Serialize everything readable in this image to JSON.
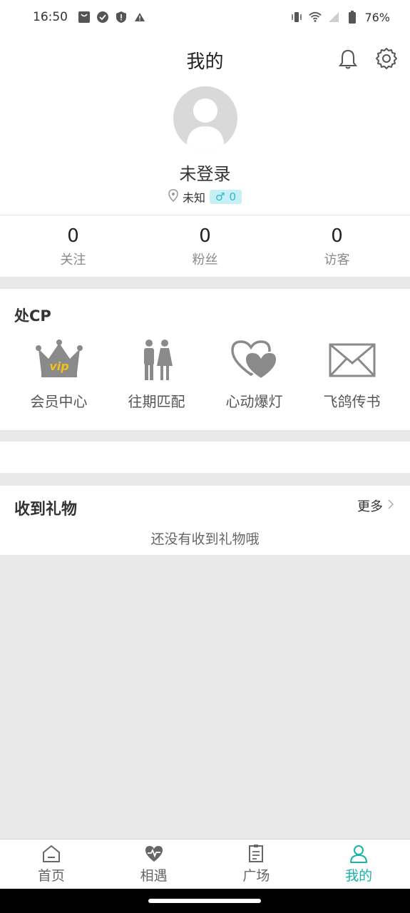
{
  "status": {
    "time": "16:50",
    "battery": "76%"
  },
  "header": {
    "title": "我的"
  },
  "profile": {
    "username": "未登录",
    "location": "未知",
    "gender_symbol": "♂",
    "gender_count": "0"
  },
  "stats": [
    {
      "value": "0",
      "label": "关注"
    },
    {
      "value": "0",
      "label": "粉丝"
    },
    {
      "value": "0",
      "label": "访客"
    }
  ],
  "cp": {
    "title": "处CP",
    "items": [
      {
        "label": "会员中心",
        "icon": "vip-crown-icon"
      },
      {
        "label": "往期匹配",
        "icon": "couple-icon"
      },
      {
        "label": "心动爆灯",
        "icon": "hearts-icon"
      },
      {
        "label": "飞鸽传书",
        "icon": "envelope-icon"
      }
    ],
    "vip_text": "vip"
  },
  "gifts": {
    "title": "收到礼物",
    "more": "更多",
    "empty": "还没有收到礼物哦"
  },
  "tabs": [
    {
      "label": "首页",
      "icon": "home-icon"
    },
    {
      "label": "相遇",
      "icon": "heartbeat-icon"
    },
    {
      "label": "广场",
      "icon": "square-icon"
    },
    {
      "label": "我的",
      "icon": "person-icon"
    }
  ],
  "colors": {
    "accent": "#19b3a5",
    "gender_bg": "#c7f0f6",
    "gender_fg": "#2bb5d0",
    "vip_gold": "#f2c21b"
  }
}
